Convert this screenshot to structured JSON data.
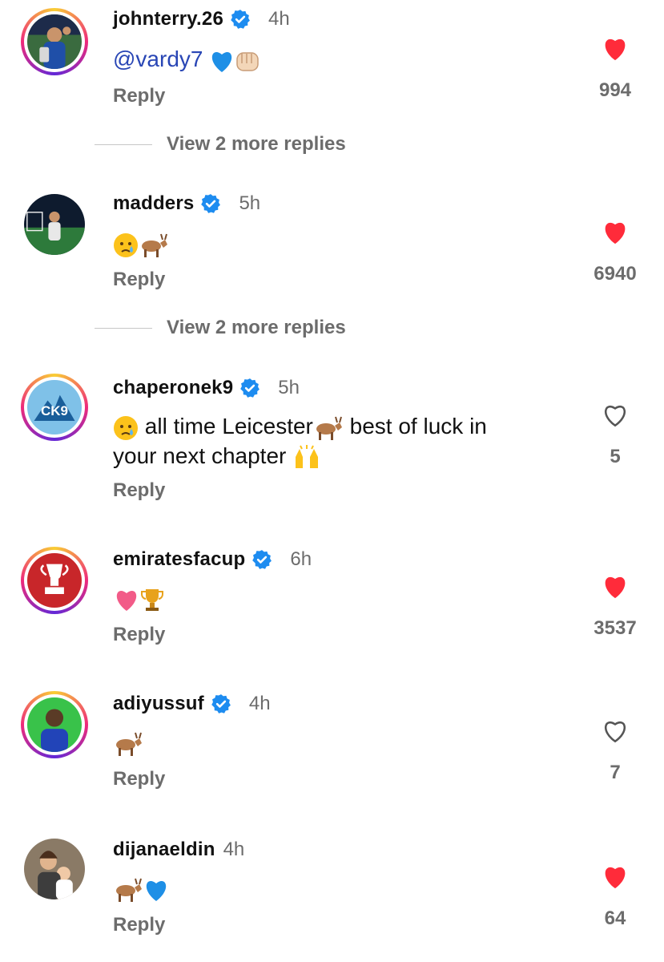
{
  "colors": {
    "like_red": "#ff2b3a",
    "verified_blue": "#1d8cf0",
    "muted": "#6c6c6c",
    "mention": "#2946b5"
  },
  "comments": [
    {
      "username": "johnterry.26",
      "verified": true,
      "time": "4h",
      "mention": "@vardy7",
      "emojis": [
        "blue-heart-emoji",
        "fist-emoji"
      ],
      "reply_label": "Reply",
      "likes": "994",
      "liked": true,
      "view_more": "View 2 more replies",
      "story_ring": true
    },
    {
      "username": "madders",
      "verified": true,
      "time": "5h",
      "emojis": [
        "crying-face-emoji",
        "goat-emoji"
      ],
      "reply_label": "Reply",
      "likes": "6940",
      "liked": true,
      "view_more": "View 2 more replies",
      "story_ring": false
    },
    {
      "username": "chaperonek9",
      "verified": true,
      "time": "5h",
      "text_a": "all time Leicester",
      "text_b": "best of luck in",
      "text_c": "your next chapter",
      "emojis": [
        "crying-face-emoji",
        "goat-emoji",
        "raising-hands-emoji"
      ],
      "reply_label": "Reply",
      "likes": "5",
      "liked": false,
      "avatar_text": "CK9",
      "story_ring": true
    },
    {
      "username": "emiratesfacup",
      "verified": true,
      "time": "6h",
      "emojis": [
        "pink-heart-emoji",
        "trophy-emoji"
      ],
      "reply_label": "Reply",
      "likes": "3537",
      "liked": true,
      "story_ring": true
    },
    {
      "username": "adiyussuf",
      "verified": true,
      "time": "4h",
      "emojis": [
        "goat-emoji"
      ],
      "reply_label": "Reply",
      "likes": "7",
      "liked": false,
      "story_ring": true
    },
    {
      "username": "dijanaeldin",
      "verified": false,
      "time": "4h",
      "emojis": [
        "goat-emoji",
        "blue-heart-emoji"
      ],
      "reply_label": "Reply",
      "likes": "64",
      "liked": true,
      "story_ring": false
    }
  ]
}
